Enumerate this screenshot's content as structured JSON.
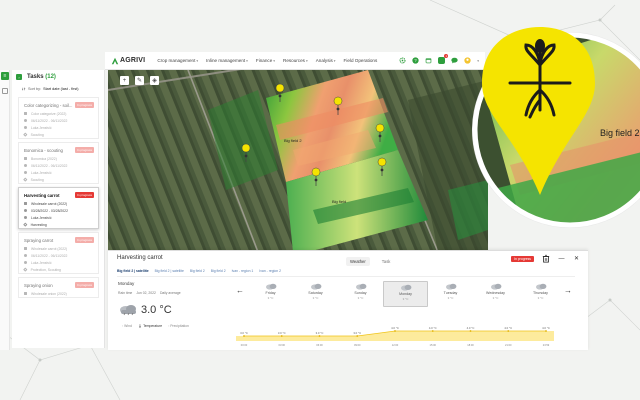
{
  "app": {
    "brand": "AGRIVI"
  },
  "nav": {
    "items": [
      "Crop management",
      "Inline management",
      "Finance",
      "Resources",
      "Analysis",
      "Field Operations"
    ],
    "notification_count": "1"
  },
  "tasks": {
    "title": "Tasks",
    "count": "(12)",
    "sort_label": "Sort by:",
    "sort_value": "Start date (last - first)",
    "cards": [
      {
        "title": "Color categorizing - soil...",
        "status": "In progress",
        "lines": [
          "Color categorize (2022)",
          "06/11/2022 - 06/11/2022",
          "Luka Jenstvić",
          "Scouting"
        ],
        "state": "faded"
      },
      {
        "title": "Bonomica - scouting",
        "status": "In progress",
        "lines": [
          "Bonomica (2022)",
          "06/11/2022 - 06/11/2022",
          "Luka Jenstvić",
          "Scouting"
        ],
        "state": "faded"
      },
      {
        "title": "Harvesting carrot",
        "status": "In progress",
        "lines": [
          "Wholesale carrot (2022)",
          "03/28/2022 - 03/28/2022",
          "Luka Jenstvić",
          "Harvesting"
        ],
        "state": "active"
      },
      {
        "title": "Spraying carrot",
        "status": "In progress",
        "lines": [
          "Wholesale carrot (2022)",
          "06/11/2022 - 06/11/2022",
          "Luka Jenstvić",
          "Protection, Scouting"
        ],
        "state": "faded"
      },
      {
        "title": "Spraying onion",
        "status": "In progress",
        "lines": [
          "Wholesale onion (2022)"
        ],
        "state": "faded"
      }
    ]
  },
  "map": {
    "labels": {
      "field_big": "Big field 2",
      "field_small": "Big field"
    }
  },
  "detail": {
    "title": "Harvesting carrot",
    "status": "In progress",
    "tabs": [
      "Weather",
      "Task"
    ],
    "active_tab": "Weather",
    "field_tabs": [
      "Big field 2 | satellite",
      "Big field 2 | satellite",
      "Big field 2",
      "Big field 2",
      "Ivan - region 1",
      "Ivan - region 2"
    ],
    "day_label": "Monday",
    "meta": [
      "Rain time",
      "Jun 02, 2022",
      "Daily average"
    ],
    "temperature": "3.0 °C",
    "metrics": [
      "Wind",
      "Temperature",
      "Precipitation"
    ],
    "prev_arrow": "←",
    "next_arrow": "→",
    "forecast": [
      {
        "day": "Friday",
        "temp": "3 °C"
      },
      {
        "day": "Saturday",
        "temp": "3 °C"
      },
      {
        "day": "Sunday",
        "temp": "3 °C"
      },
      {
        "day": "Monday",
        "temp": "3 °C",
        "selected": true
      },
      {
        "day": "Tuesday",
        "temp": "3 °C"
      },
      {
        "day": "Wednesday",
        "temp": "3 °C"
      },
      {
        "day": "Thursday",
        "temp": "3 °C"
      }
    ],
    "chart": {
      "point_labels": [
        "3.0 °C",
        "3.0 °C",
        "3.0 °C",
        "3.0 °C",
        "4.0 °C",
        "4.0 °C",
        "4.0 °C",
        "4.0 °C",
        "4.0 °C"
      ],
      "time_labels": [
        "00:00",
        "03:00",
        "06:00",
        "09:00",
        "12:00",
        "15:00",
        "18:00",
        "21:00",
        "23:59"
      ],
      "values": [
        3,
        3,
        3,
        3,
        4,
        4,
        4,
        4,
        4
      ]
    }
  },
  "colors": {
    "brand_green": "#2e9e3d",
    "status_red": "#e53935",
    "accent_yellow": "#f5e400",
    "chart_fill": "#fdeb9d"
  }
}
